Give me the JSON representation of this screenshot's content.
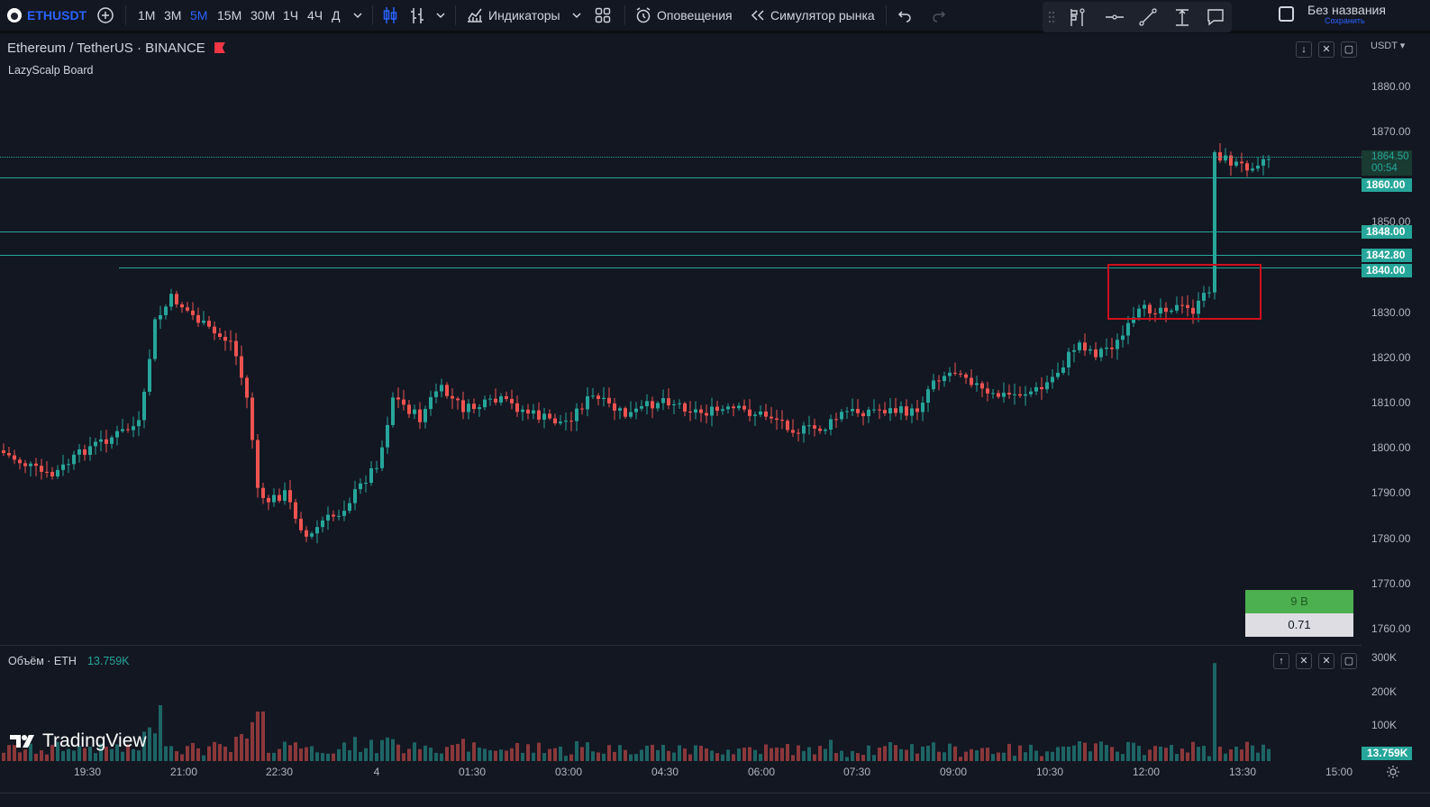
{
  "toolbar": {
    "symbol": "ETHUSDT",
    "timeframes": [
      "1М",
      "3М",
      "5М",
      "15М",
      "30М",
      "1Ч",
      "4Ч",
      "Д"
    ],
    "active_timeframe": "5М",
    "indicators_label": "Индикаторы",
    "alerts_label": "Оповещения",
    "replay_label": "Симулятор рынка",
    "layout_title": "Без названия",
    "save_label": "Сохранить"
  },
  "legend": {
    "title": "Ethereum / TetherUS · BINANCE",
    "indicator": "LazyScalp Board"
  },
  "price_axis": {
    "currency": "USDT",
    "ticks": [
      "1880.00",
      "1870.00",
      "1850.00",
      "1830.00",
      "1820.00",
      "1810.00",
      "1800.00",
      "1790.00",
      "1780.00",
      "1770.00",
      "1760.00"
    ],
    "current_price": "1864.50",
    "countdown": "00:54",
    "levels": [
      "1860.00",
      "1848.00",
      "1842.80",
      "1840.00"
    ]
  },
  "widget": {
    "row1": "9 B",
    "row2": "0.71"
  },
  "volume": {
    "label": "Объём · ETH",
    "value": "13.759K",
    "ticks": [
      "300K",
      "200K",
      "100K"
    ],
    "current": "13.759K"
  },
  "time_axis": [
    "19:30",
    "21:00",
    "22:30",
    "4",
    "01:30",
    "03:00",
    "04:30",
    "06:00",
    "07:30",
    "09:00",
    "10:30",
    "12:00",
    "13:30",
    "15:00"
  ],
  "branding": "TradingView",
  "colors": {
    "up": "#26a69a",
    "down": "#ef5350",
    "accent": "#2962ff",
    "background": "#131722"
  }
}
